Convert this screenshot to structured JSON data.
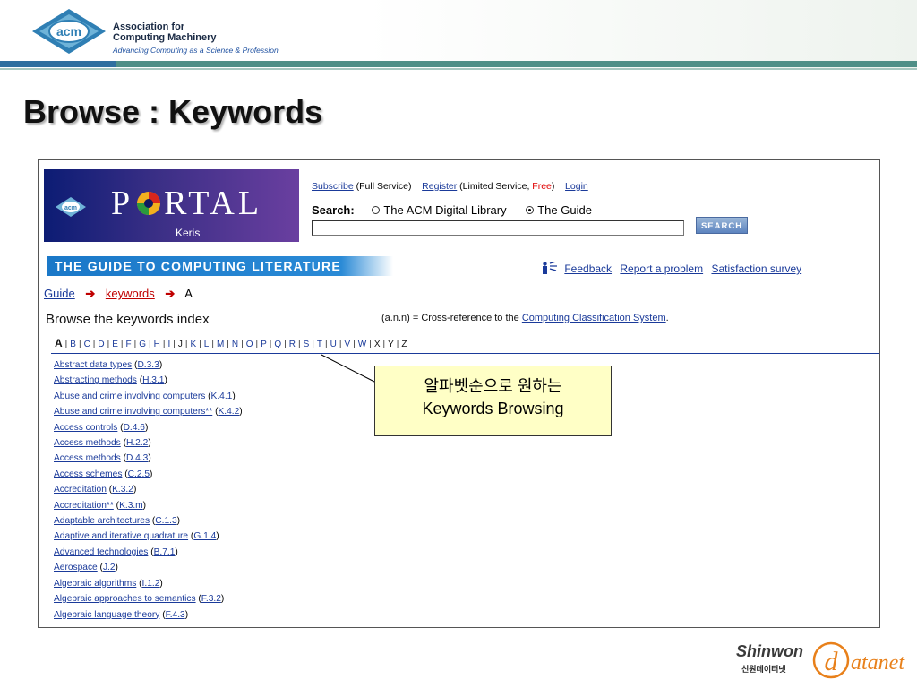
{
  "header": {
    "org_line1": "Association for",
    "org_line2": "Computing Machinery",
    "tagline": "Advancing Computing as a Science & Profession",
    "logo_text": "acm"
  },
  "slide_title": "Browse : Keywords",
  "portal": {
    "logo_text": "acm",
    "word_p": "P",
    "word_rest": "RTAL",
    "subtitle": "Keris"
  },
  "top_links": {
    "subscribe": "Subscribe",
    "subscribe_note": "(Full Service)",
    "register": "Register",
    "register_note_pre": "(Limited Service, ",
    "register_note_free": "Free",
    "register_note_post": ")",
    "login": "Login"
  },
  "search": {
    "label": "Search:",
    "option_acm": "The ACM Digital Library",
    "option_guide": "The Guide",
    "selected": "The Guide",
    "value": "",
    "button": "SEARCH"
  },
  "guide_banner": "THE GUIDE TO COMPUTING LITERATURE",
  "feedback_links": {
    "feedback": "Feedback",
    "report": "Report a problem",
    "survey": "Satisfaction survey"
  },
  "breadcrumb": {
    "guide": "Guide",
    "keywords": "keywords",
    "current": "A",
    "arrow": "➔"
  },
  "browse_heading": "Browse the keywords index",
  "xref_note": {
    "prefix": "(a.n.n) = Cross-reference to the ",
    "link": "Computing Classification System",
    "suffix": "."
  },
  "alphabet": [
    {
      "letter": "A",
      "state": "current"
    },
    {
      "letter": "B",
      "state": "link"
    },
    {
      "letter": "C",
      "state": "link"
    },
    {
      "letter": "D",
      "state": "link"
    },
    {
      "letter": "E",
      "state": "link"
    },
    {
      "letter": "F",
      "state": "link"
    },
    {
      "letter": "G",
      "state": "link"
    },
    {
      "letter": "H",
      "state": "link"
    },
    {
      "letter": "I",
      "state": "link"
    },
    {
      "letter": "J",
      "state": "plain"
    },
    {
      "letter": "K",
      "state": "link"
    },
    {
      "letter": "L",
      "state": "link"
    },
    {
      "letter": "M",
      "state": "link"
    },
    {
      "letter": "N",
      "state": "link"
    },
    {
      "letter": "O",
      "state": "link"
    },
    {
      "letter": "P",
      "state": "link"
    },
    {
      "letter": "Q",
      "state": "link"
    },
    {
      "letter": "R",
      "state": "link"
    },
    {
      "letter": "S",
      "state": "link"
    },
    {
      "letter": "T",
      "state": "link"
    },
    {
      "letter": "U",
      "state": "link"
    },
    {
      "letter": "V",
      "state": "link"
    },
    {
      "letter": "W",
      "state": "link"
    },
    {
      "letter": "X",
      "state": "plain"
    },
    {
      "letter": "Y",
      "state": "plain"
    },
    {
      "letter": "Z",
      "state": "plain"
    }
  ],
  "keywords": [
    {
      "name": "Abstract data types",
      "code": "D.3.3"
    },
    {
      "name": "Abstracting methods",
      "code": "H.3.1"
    },
    {
      "name": "Abuse and crime involving computers",
      "code": "K.4.1"
    },
    {
      "name": "Abuse and crime involving computers**",
      "code": "K.4.2"
    },
    {
      "name": "Access controls",
      "code": "D.4.6"
    },
    {
      "name": "Access methods",
      "code": "H.2.2"
    },
    {
      "name": "Access methods",
      "code": "D.4.3"
    },
    {
      "name": "Access schemes",
      "code": "C.2.5"
    },
    {
      "name": "Accreditation",
      "code": "K.3.2"
    },
    {
      "name": "Accreditation**",
      "code": "K.3.m"
    },
    {
      "name": "Adaptable architectures",
      "code": "C.1.3"
    },
    {
      "name": "Adaptive and iterative quadrature",
      "code": "G.1.4"
    },
    {
      "name": "Advanced technologies",
      "code": "B.7.1"
    },
    {
      "name": "Aerospace",
      "code": "J.2"
    },
    {
      "name": "Algebraic algorithms",
      "code": "I.1.2"
    },
    {
      "name": "Algebraic approaches to semantics",
      "code": "F.3.2"
    },
    {
      "name": "Algebraic language theory",
      "code": "F.4.3"
    }
  ],
  "callout": {
    "line1": "알파벳순으로 원하는",
    "line2": "Keywords Browsing"
  },
  "footer": {
    "brand": "Shinwon",
    "brand_korean": "신원데이터넷",
    "at_glyph": "d",
    "datanet": "atanet"
  },
  "colors": {
    "link": "#1a3a9a",
    "banner_blue": "#1a78c8",
    "header_teal": "#4f8f87",
    "callout_bg": "#ffffc6",
    "datanet_orange": "#e8801a"
  }
}
